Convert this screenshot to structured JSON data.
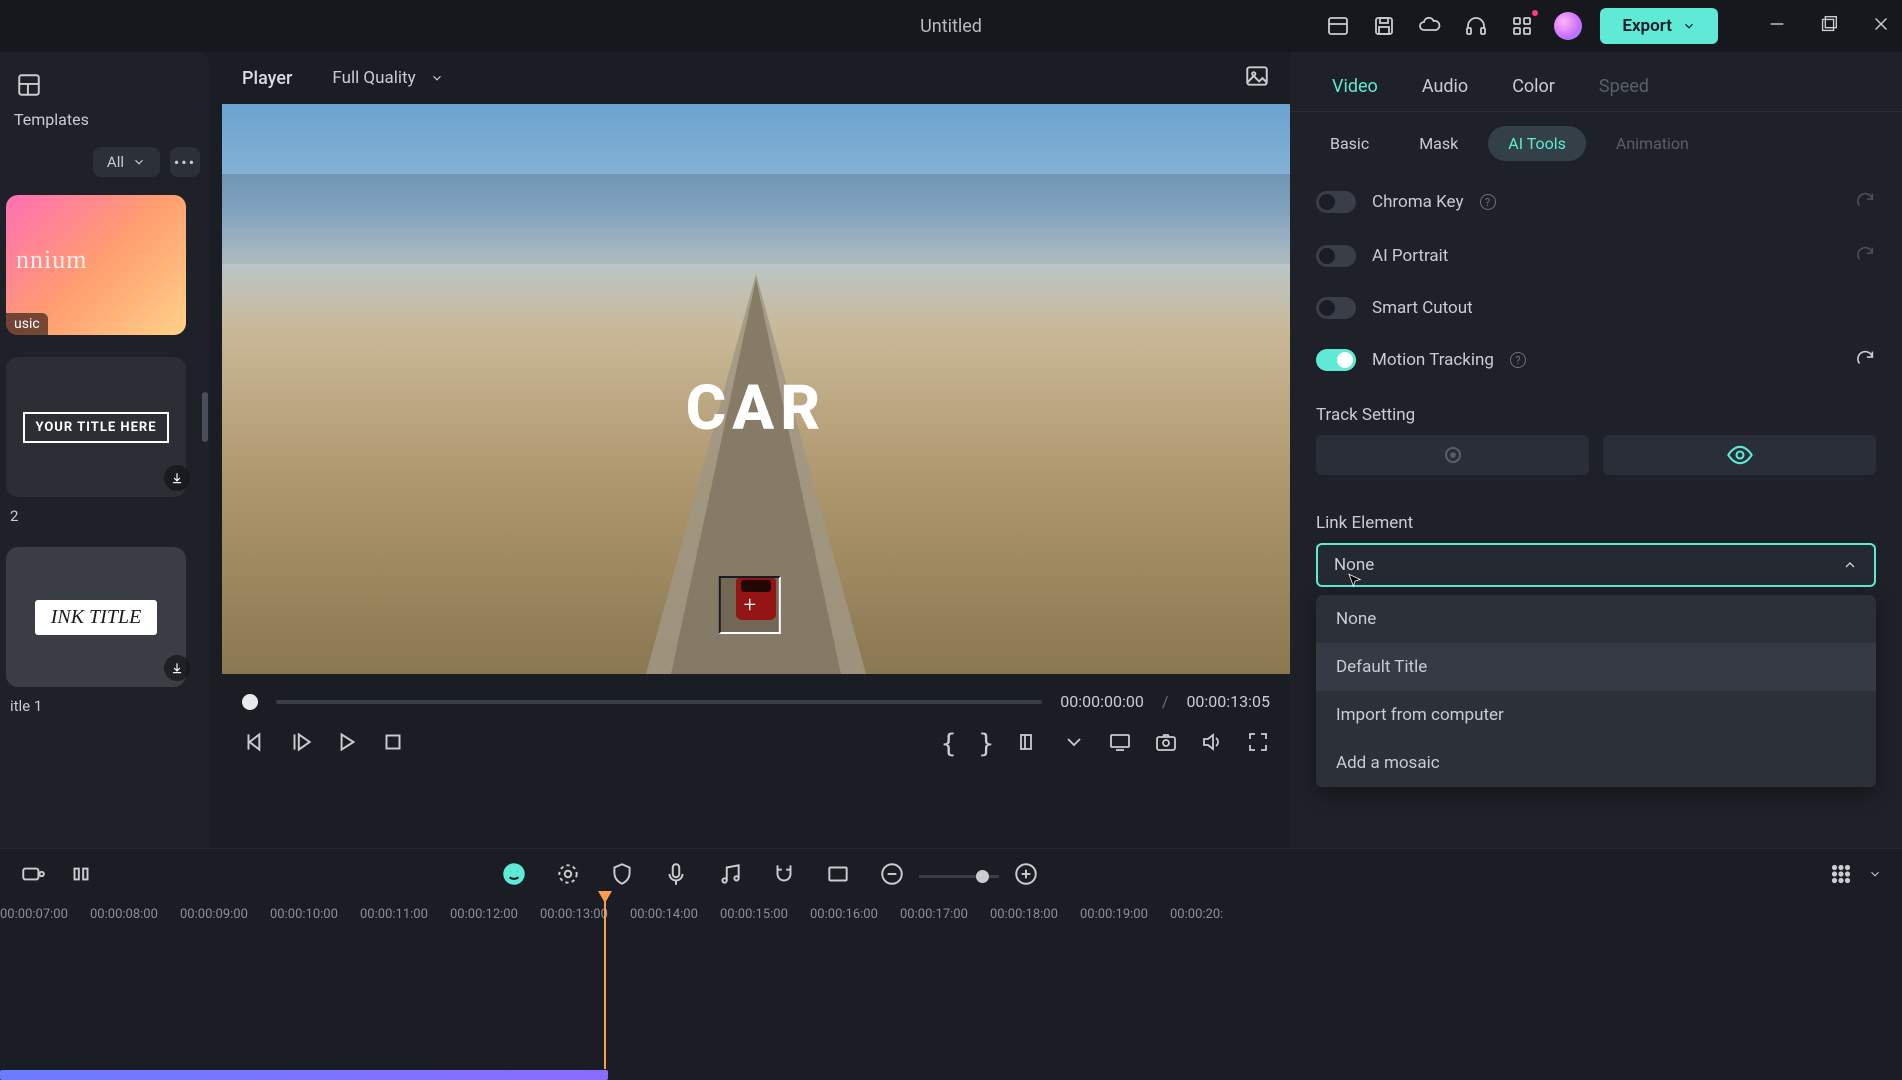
{
  "titlebar": {
    "title": "Untitled",
    "export_label": "Export"
  },
  "left": {
    "templates_label": "Templates",
    "filter_label": "All",
    "cards": [
      {
        "thumb_text": "nnium",
        "tag": "usic",
        "name": ""
      },
      {
        "thumb_text": "YOUR TITLE HERE",
        "name": "2"
      },
      {
        "thumb_text": "INK TITLE",
        "name": "itle 1"
      }
    ]
  },
  "player": {
    "label": "Player",
    "quality": "Full Quality",
    "overlay_text": "CAR",
    "current_time": "00:00:00:00",
    "separator": "/",
    "total_time": "00:00:13:05"
  },
  "right": {
    "tabs": {
      "video": "Video",
      "audio": "Audio",
      "color": "Color",
      "speed": "Speed"
    },
    "subtabs": {
      "basic": "Basic",
      "mask": "Mask",
      "ai": "AI Tools",
      "animation": "Animation"
    },
    "toggles": {
      "chroma": "Chroma Key",
      "portrait": "AI Portrait",
      "cutout": "Smart Cutout",
      "motion": "Motion Tracking"
    },
    "track_setting": "Track Setting",
    "link_element": "Link Element",
    "link_value": "None",
    "dropdown": [
      "None",
      "Default Title",
      "Import from computer",
      "Add a mosaic"
    ]
  },
  "timeline": {
    "ticks": [
      "00:00:07:00",
      "00:00:08:00",
      "00:00:09:00",
      "00:00:10:00",
      "00:00:11:00",
      "00:00:12:00",
      "00:00:13:00",
      "00:00:14:00",
      "00:00:15:00",
      "00:00:16:00",
      "00:00:17:00",
      "00:00:18:00",
      "00:00:19:00",
      "00:00:20:"
    ]
  }
}
